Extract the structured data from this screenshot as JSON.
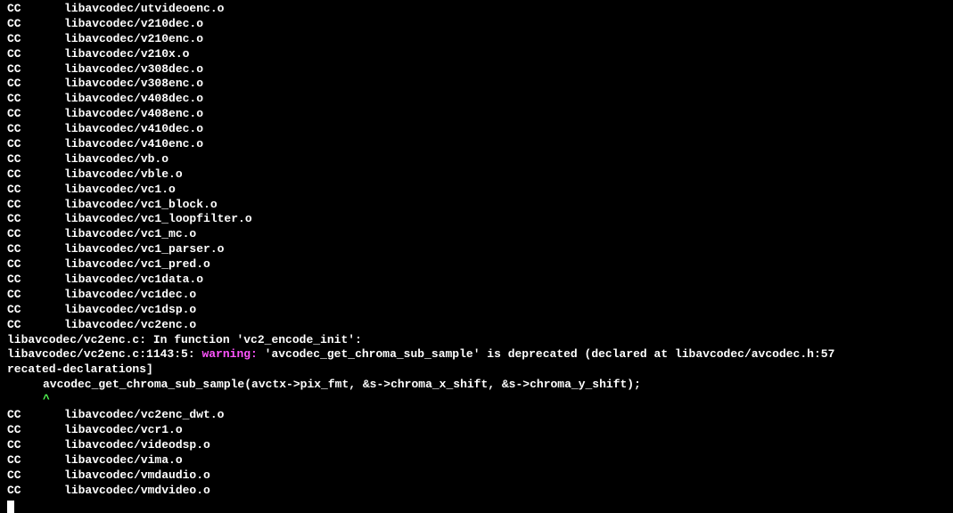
{
  "cc_prefix": "CC",
  "lines_before": [
    "libavcodec/utvideoenc.o",
    "libavcodec/v210dec.o",
    "libavcodec/v210enc.o",
    "libavcodec/v210x.o",
    "libavcodec/v308dec.o",
    "libavcodec/v308enc.o",
    "libavcodec/v408dec.o",
    "libavcodec/v408enc.o",
    "libavcodec/v410dec.o",
    "libavcodec/v410enc.o",
    "libavcodec/vb.o",
    "libavcodec/vble.o",
    "libavcodec/vc1.o",
    "libavcodec/vc1_block.o",
    "libavcodec/vc1_loopfilter.o",
    "libavcodec/vc1_mc.o",
    "libavcodec/vc1_parser.o",
    "libavcodec/vc1_pred.o",
    "libavcodec/vc1data.o",
    "libavcodec/vc1dec.o",
    "libavcodec/vc1dsp.o",
    "libavcodec/vc2enc.o"
  ],
  "warning": {
    "file_prefix": "libavcodec/vc2enc.c:",
    "in_function_text": " In function ",
    "function_name": "'vc2_encode_init':",
    "location": "libavcodec/vc2enc.c:1143:5: ",
    "warning_label": "warning: ",
    "deprecated_func": "'avcodec_get_chroma_sub_sample'",
    "deprecated_msg": " is deprecated (declared at ",
    "declared_at": "libavcodec/avcodec.h:57",
    "flag_line": "recated-declarations]",
    "code_line": "avcodec_get_chroma_sub_sample(avctx->pix_fmt, &s->chroma_x_shift, &s->chroma_y_shift);",
    "caret": "^"
  },
  "lines_after": [
    "libavcodec/vc2enc_dwt.o",
    "libavcodec/vcr1.o",
    "libavcodec/videodsp.o",
    "libavcodec/vima.o",
    "libavcodec/vmdaudio.o",
    "libavcodec/vmdvideo.o"
  ]
}
